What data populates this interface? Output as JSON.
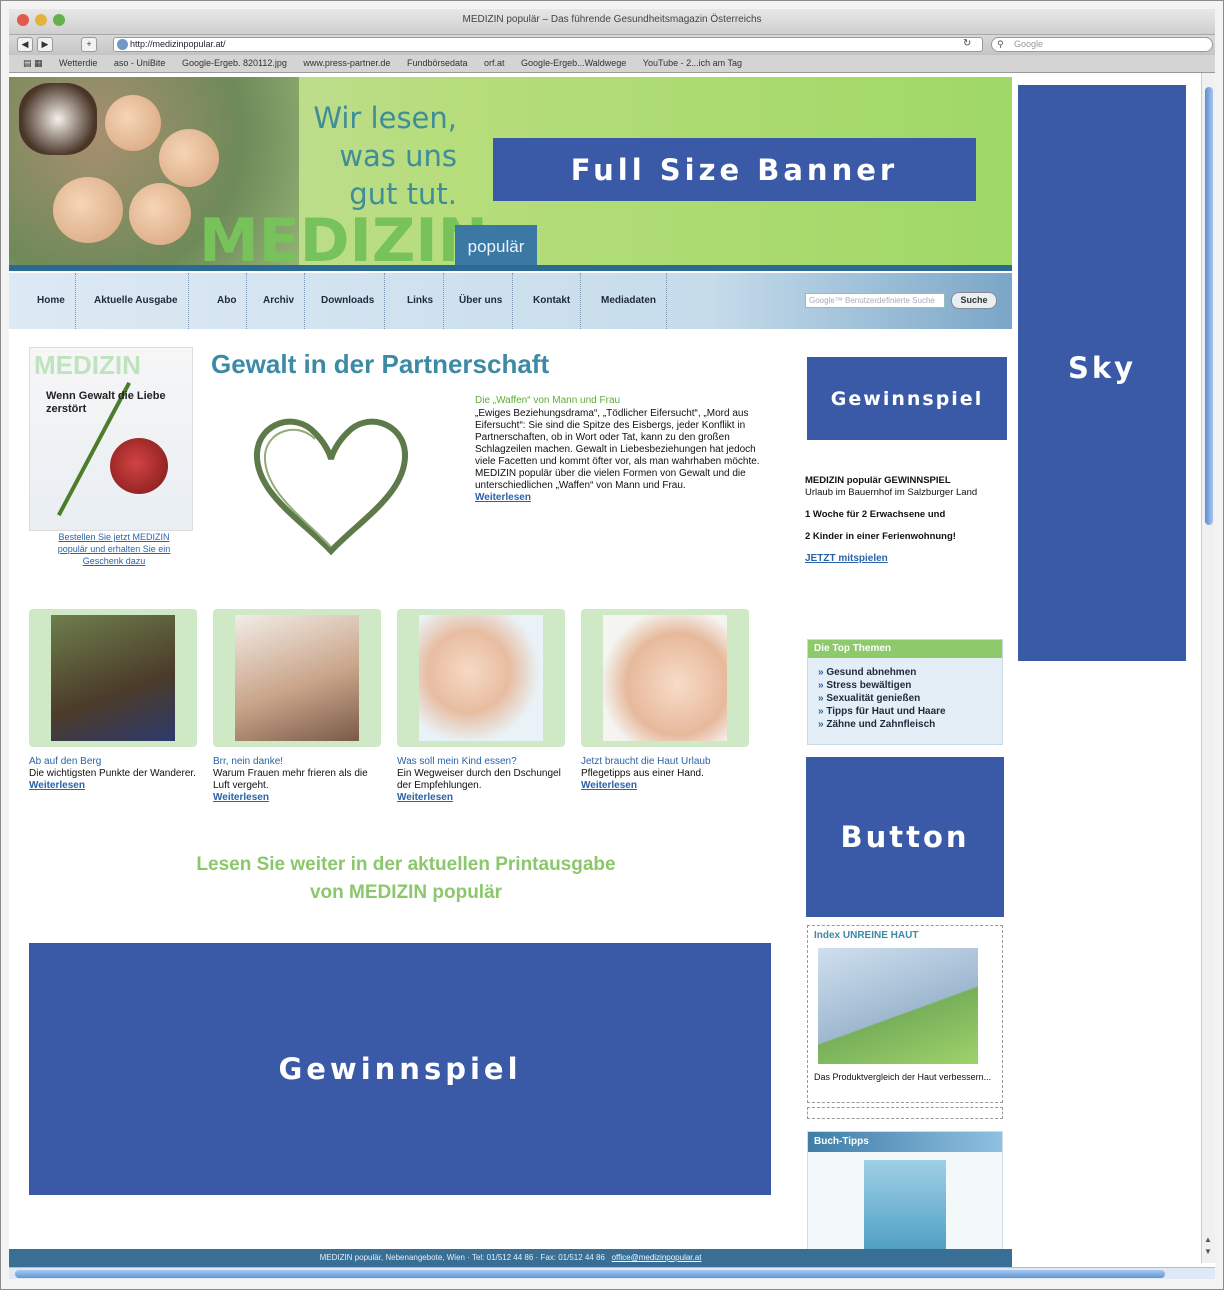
{
  "browser": {
    "window_title": "MEDIZIN populär – Das führende Gesundheitsmagazin Österreichs",
    "url": "http://medizinpopular.at/",
    "search_placeholder": "Google",
    "bookmarks": [
      "Wetterdie",
      "aso - UniBite",
      "Google-Ergeb. 820112.jpg",
      "www.press-partner.de",
      "Fundbörsedata",
      "orf.at",
      "Google-Ergeb...Waldwege",
      "YouTube - 2...ich am Tag"
    ]
  },
  "header": {
    "slogan_line1": "Wir lesen,",
    "slogan_line2": "was uns",
    "slogan_line3": "gut tut.",
    "logo_main": "MEDIZIN",
    "logo_sub": "populär"
  },
  "ads": {
    "full_size_banner": "Full Size Banner",
    "sky": "Sky",
    "gewinnspiel_small": "Gewinnspiel",
    "button": "Button",
    "gewinnspiel_large": "Gewinnspiel"
  },
  "nav": {
    "items": [
      "Home",
      "Aktuelle Ausgabe",
      "Abo",
      "Archiv",
      "Downloads",
      "Links",
      "Über uns",
      "Kontakt",
      "Mediadaten"
    ],
    "search_placeholder": "Google™ Benutzerdefinierte Suche",
    "search_button": "Suche"
  },
  "article": {
    "title": "Gewalt in der Partnerschaft",
    "magazine_title": "MEDIZIN",
    "magazine_headline": "Wenn Gewalt die Liebe zerstört",
    "magazine_caption": "Bestellen Sie jetzt MEDIZIN populär und erhalten Sie ein Geschenk dazu",
    "kicker": "Die „Waffen“ von Mann und Frau",
    "body": "„Ewiges Beziehungsdrama“, „Tödlicher Eifersucht“, „Mord aus Eifersucht“: Sie sind die Spitze des Eisbergs, jeder Konflikt in Partnerschaften, ob in Wort oder Tat, kann zu den großen Schlagzeilen machen. Gewalt in Liebesbeziehungen hat jedoch viele Facetten und kommt öfter vor, als man wahrhaben möchte. MEDIZIN populär über die vielen Formen von Gewalt und die unterschiedlichen „Waffen“ von Mann und Frau.",
    "more": "Weiterlesen"
  },
  "teasers": [
    {
      "title": "Ab auf den Berg",
      "text": "Die wichtigsten Punkte der Wanderer.",
      "more": "Weiterlesen"
    },
    {
      "title": "Brr, nein danke!",
      "text": "Warum Frauen mehr frieren als die Luft vergeht.",
      "more": "Weiterlesen"
    },
    {
      "title": "Was soll mein Kind essen?",
      "text": "Ein Wegweiser durch den Dschungel der Empfehlungen.",
      "more": "Weiterlesen"
    },
    {
      "title": "Jetzt braucht die Haut Urlaub",
      "text": "Pflegetipps aus einer Hand.",
      "more": "Weiterlesen"
    }
  ],
  "print_line1": "Lesen Sie weiter in der aktuellen Printausgabe",
  "print_line2": "von MEDIZIN populär",
  "sidebar": {
    "contest_heading": "MEDIZIN populär GEWINNSPIEL",
    "contest_line1": "Urlaub im Bauernhof im Salzburger Land",
    "contest_line2": "1 Woche für 2 Erwachsene und",
    "contest_line3": "2 Kinder in einer Ferienwohnung!",
    "contest_link": "JETZT mitspielen",
    "themes_heading": "Die Top Themen",
    "themes": [
      "Gesund abnehmen",
      "Stress bewältigen",
      "Sexualität genießen",
      "Tipps für Haut und Haare",
      "Zähne und Zahnfleisch"
    ],
    "skin_heading": "Index UNREINE HAUT",
    "skin_caption": "Das Produktvergleich der Haut verbessern...",
    "books_heading": "Buch-Tipps"
  },
  "footer": {
    "text": "MEDIZIN populär, Nebenangebote, Wien · Tel: 01/512 44 86 · Fax: 01/512 44 86",
    "link": "office@medizinpopular.at"
  }
}
